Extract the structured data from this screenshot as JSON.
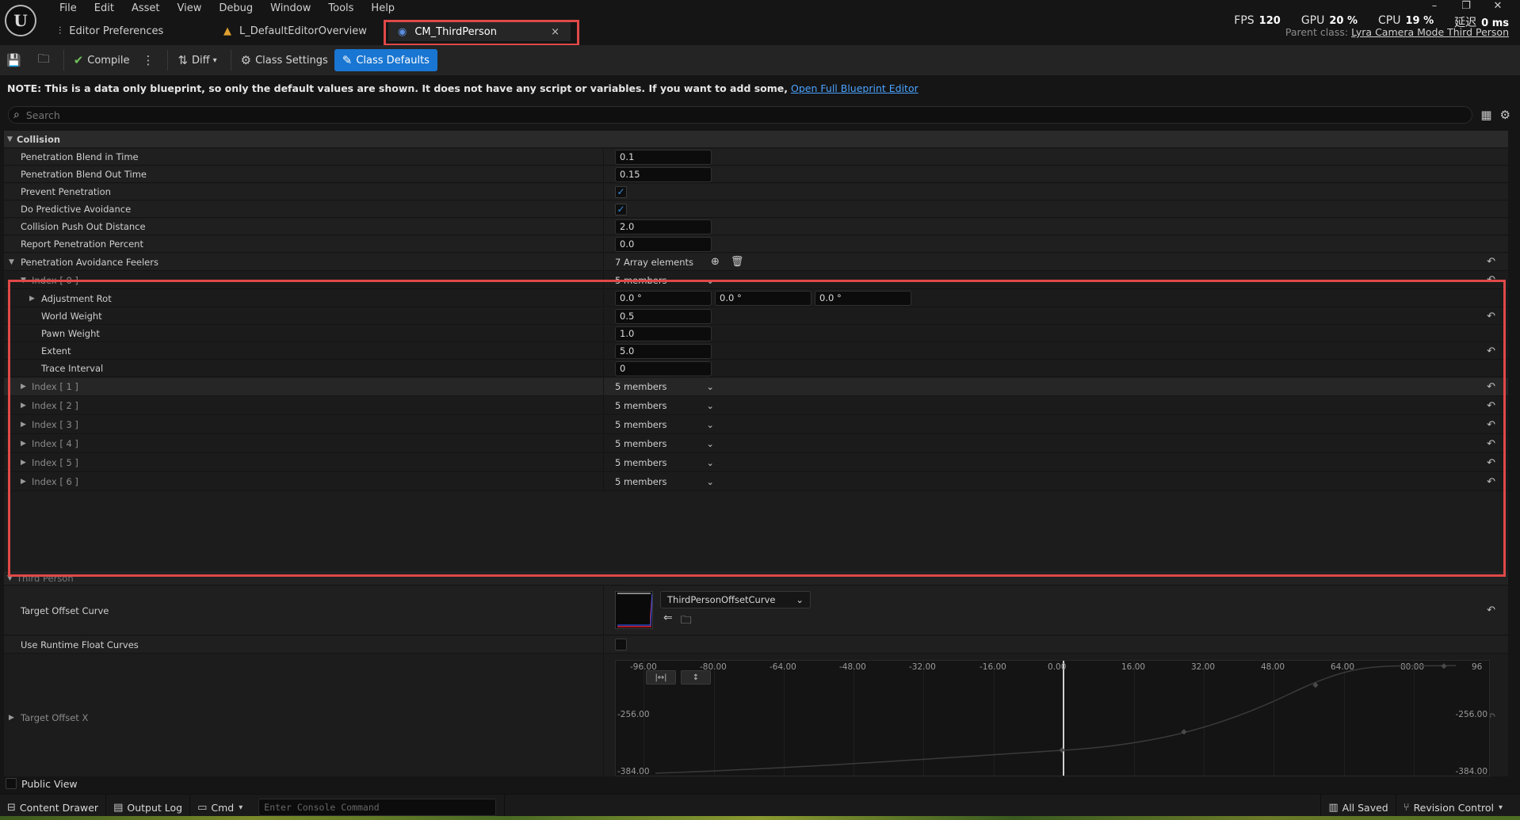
{
  "menu": [
    "File",
    "Edit",
    "Asset",
    "View",
    "Debug",
    "Window",
    "Tools",
    "Help"
  ],
  "tabs": [
    {
      "label": "Editor Preferences",
      "icon": "sliders-icon"
    },
    {
      "label": "L_DefaultEditorOverview",
      "icon": "level-icon"
    },
    {
      "label": "CM_ThirdPerson",
      "icon": "blueprint-icon",
      "close": "×"
    }
  ],
  "stats": {
    "fps_label": "FPS",
    "fps": "120",
    "gpu_label": "GPU",
    "gpu": "20 %",
    "cpu_label": "CPU",
    "cpu": "19 %",
    "lat_label": "延迟",
    "lat": "0 ms"
  },
  "parent_class": {
    "label": "Parent class:",
    "value": "Lyra Camera Mode Third Person"
  },
  "toolbar": {
    "compile": "Compile",
    "diff": "Diff",
    "class_settings": "Class Settings",
    "class_defaults": "Class Defaults"
  },
  "note": {
    "bold": "NOTE: This is a data only blueprint, so only the default values are shown.  It does not have any script or variables.  If you want to add some,",
    "link": "Open Full Blueprint Editor"
  },
  "search": {
    "placeholder": "Search"
  },
  "collision": {
    "header": "Collision",
    "blend_in": {
      "label": "Penetration Blend in Time",
      "value": "0.1"
    },
    "blend_out": {
      "label": "Penetration Blend Out Time",
      "value": "0.15"
    },
    "prevent": {
      "label": "Prevent Penetration",
      "checked": true
    },
    "predictive": {
      "label": "Do Predictive Avoidance",
      "checked": true
    },
    "push_out": {
      "label": "Collision Push Out Distance",
      "value": "2.0"
    },
    "report": {
      "label": "Report Penetration Percent",
      "value": "0.0"
    },
    "feelers": {
      "label": "Penetration Avoidance Feelers",
      "count": "7 Array elements",
      "index0": {
        "label": "Index [ 0 ]",
        "members": "5 members",
        "adjustment_rot": {
          "label": "Adjustment Rot",
          "x": "0.0 °",
          "y": "0.0 °",
          "z": "0.0 °"
        },
        "world_weight": {
          "label": "World Weight",
          "value": "0.5"
        },
        "pawn_weight": {
          "label": "Pawn Weight",
          "value": "1.0"
        },
        "extent": {
          "label": "Extent",
          "value": "5.0"
        },
        "trace_interval": {
          "label": "Trace Interval",
          "value": "0"
        }
      },
      "others": [
        {
          "label": "Index [ 1 ]",
          "members": "5 members"
        },
        {
          "label": "Index [ 2 ]",
          "members": "5 members"
        },
        {
          "label": "Index [ 3 ]",
          "members": "5 members"
        },
        {
          "label": "Index [ 4 ]",
          "members": "5 members"
        },
        {
          "label": "Index [ 5 ]",
          "members": "5 members"
        },
        {
          "label": "Index [ 6 ]",
          "members": "5 members"
        }
      ]
    }
  },
  "third_person": {
    "header": "Third Person",
    "target_offset_curve": {
      "label": "Target Offset Curve",
      "asset": "ThirdPersonOffsetCurve"
    },
    "use_runtime": {
      "label": "Use Runtime Float Curves",
      "checked": false
    },
    "target_offset_x": {
      "label": "Target Offset X"
    },
    "graph": {
      "x_ticks": [
        "-96.00",
        "-80.00",
        "-64.00",
        "-48.00",
        "-32.00",
        "-16.00",
        "0.00",
        "16.00",
        "32.00",
        "48.00",
        "64.00",
        "80.00",
        "96"
      ],
      "y_ticks_left": [
        "-256.00",
        "-384.00"
      ],
      "y_ticks_right": [
        "-256.00",
        "-384.00"
      ]
    }
  },
  "public_view": "Public View",
  "statusbar": {
    "content_drawer": "Content Drawer",
    "output_log": "Output Log",
    "cmd": "Cmd",
    "console_placeholder": "Enter Console Command",
    "all_saved": "All Saved",
    "revision_control": "Revision Control"
  },
  "colors": {
    "accent": "#1976d2",
    "highlight": "#e04848",
    "check": "#3a8fe0"
  }
}
